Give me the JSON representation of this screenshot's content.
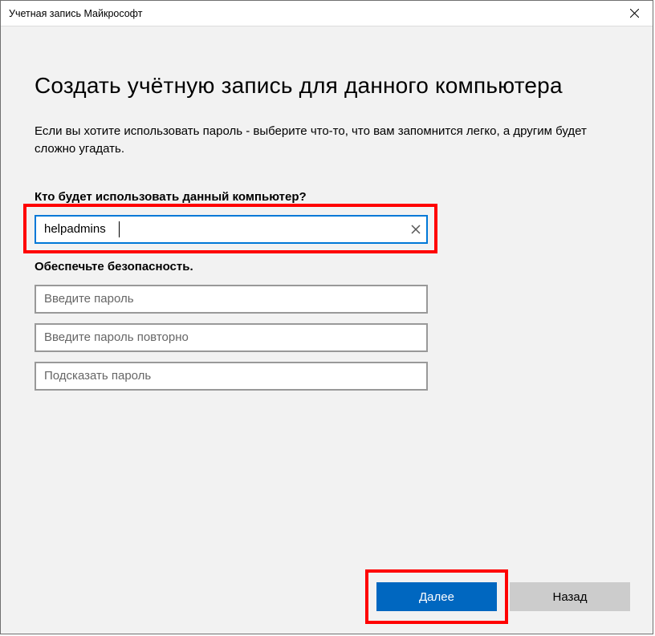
{
  "window": {
    "title": "Учетная запись Майкрософт"
  },
  "heading": "Создать учётную запись для данного компьютера",
  "subtext": "Если вы хотите использовать пароль - выберите что-то, что вам запомнится легко, а другим будет сложно угадать.",
  "username": {
    "label": "Кто будет использовать данный компьютер?",
    "value": "helpadmins"
  },
  "security": {
    "label": "Обеспечьте безопасность.",
    "password_placeholder": "Введите пароль",
    "password_confirm_placeholder": "Введите пароль повторно",
    "hint_placeholder": "Подсказать пароль"
  },
  "buttons": {
    "next": "Далее",
    "back": "Назад"
  }
}
